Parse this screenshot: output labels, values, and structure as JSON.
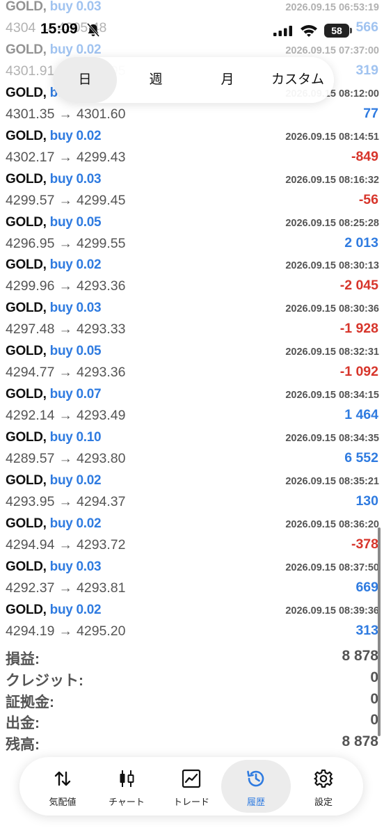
{
  "status_bar": {
    "time": "15:09",
    "battery": "58"
  },
  "period_tabs": [
    {
      "label": "日",
      "active": true
    },
    {
      "label": "週",
      "active": false
    },
    {
      "label": "月",
      "active": false
    },
    {
      "label": "カスタム",
      "active": false
    }
  ],
  "trades": [
    {
      "symbol": "GOLD,",
      "direction": "buy",
      "volume": "0.03",
      "time": "2026.09.15 06:53:19",
      "open": "4304",
      "close": "4305.48",
      "profit": "566",
      "sign": "pos",
      "partial": true
    },
    {
      "symbol": "GOLD,",
      "direction": "buy",
      "volume": "0.02",
      "time": "2026.09.15 07:37:00",
      "open": "4301.91",
      "close": "4302.95",
      "profit": "319",
      "sign": "pos",
      "partial": true
    },
    {
      "symbol": "GOLD,",
      "direction": "buy",
      "volume": "0.03",
      "time": "2026.09.15 08:12:00",
      "open": "4301.35",
      "close": "4301.60",
      "profit": "77",
      "sign": "pos",
      "partial": false
    },
    {
      "symbol": "GOLD,",
      "direction": "buy",
      "volume": "0.02",
      "time": "2026.09.15 08:14:51",
      "open": "4302.17",
      "close": "4299.43",
      "profit": "-849",
      "sign": "neg",
      "partial": false
    },
    {
      "symbol": "GOLD,",
      "direction": "buy",
      "volume": "0.03",
      "time": "2026.09.15 08:16:32",
      "open": "4299.57",
      "close": "4299.45",
      "profit": "-56",
      "sign": "neg",
      "partial": false
    },
    {
      "symbol": "GOLD,",
      "direction": "buy",
      "volume": "0.05",
      "time": "2026.09.15 08:25:28",
      "open": "4296.95",
      "close": "4299.55",
      "profit": "2 013",
      "sign": "pos",
      "partial": false
    },
    {
      "symbol": "GOLD,",
      "direction": "buy",
      "volume": "0.02",
      "time": "2026.09.15 08:30:13",
      "open": "4299.96",
      "close": "4293.36",
      "profit": "-2 045",
      "sign": "neg",
      "partial": false
    },
    {
      "symbol": "GOLD,",
      "direction": "buy",
      "volume": "0.03",
      "time": "2026.09.15 08:30:36",
      "open": "4297.48",
      "close": "4293.33",
      "profit": "-1 928",
      "sign": "neg",
      "partial": false
    },
    {
      "symbol": "GOLD,",
      "direction": "buy",
      "volume": "0.05",
      "time": "2026.09.15 08:32:31",
      "open": "4294.77",
      "close": "4293.36",
      "profit": "-1 092",
      "sign": "neg",
      "partial": false
    },
    {
      "symbol": "GOLD,",
      "direction": "buy",
      "volume": "0.07",
      "time": "2026.09.15 08:34:15",
      "open": "4292.14",
      "close": "4293.49",
      "profit": "1 464",
      "sign": "pos",
      "partial": false
    },
    {
      "symbol": "GOLD,",
      "direction": "buy",
      "volume": "0.10",
      "time": "2026.09.15 08:34:35",
      "open": "4289.57",
      "close": "4293.80",
      "profit": "6 552",
      "sign": "pos",
      "partial": false
    },
    {
      "symbol": "GOLD,",
      "direction": "buy",
      "volume": "0.02",
      "time": "2026.09.15 08:35:21",
      "open": "4293.95",
      "close": "4294.37",
      "profit": "130",
      "sign": "pos",
      "partial": false
    },
    {
      "symbol": "GOLD,",
      "direction": "buy",
      "volume": "0.02",
      "time": "2026.09.15 08:36:20",
      "open": "4294.94",
      "close": "4293.72",
      "profit": "-378",
      "sign": "neg",
      "partial": false
    },
    {
      "symbol": "GOLD,",
      "direction": "buy",
      "volume": "0.03",
      "time": "2026.09.15 08:37:50",
      "open": "4292.37",
      "close": "4293.81",
      "profit": "669",
      "sign": "pos",
      "partial": false
    },
    {
      "symbol": "GOLD,",
      "direction": "buy",
      "volume": "0.02",
      "time": "2026.09.15 08:39:36",
      "open": "4294.19",
      "close": "4295.20",
      "profit": "313",
      "sign": "pos",
      "partial": false
    }
  ],
  "arrow": "→",
  "summary": [
    {
      "label": "損益:",
      "value": "8 878"
    },
    {
      "label": "クレジット:",
      "value": "0"
    },
    {
      "label": "証拠金:",
      "value": "0"
    },
    {
      "label": "出金:",
      "value": "0"
    },
    {
      "label": "残高:",
      "value": "8 878"
    }
  ],
  "nav_tabs": [
    {
      "label": "気配値",
      "icon": "arrows-updown-icon",
      "active": false
    },
    {
      "label": "チャート",
      "icon": "candlestick-icon",
      "active": false
    },
    {
      "label": "トレード",
      "icon": "trade-chart-icon",
      "active": false
    },
    {
      "label": "履歴",
      "icon": "history-icon",
      "active": true
    },
    {
      "label": "設定",
      "icon": "gear-icon",
      "active": false
    }
  ],
  "colors": {
    "accent_blue": "#2f7be0",
    "loss_red": "#d7352b",
    "text_gray": "#555555"
  }
}
